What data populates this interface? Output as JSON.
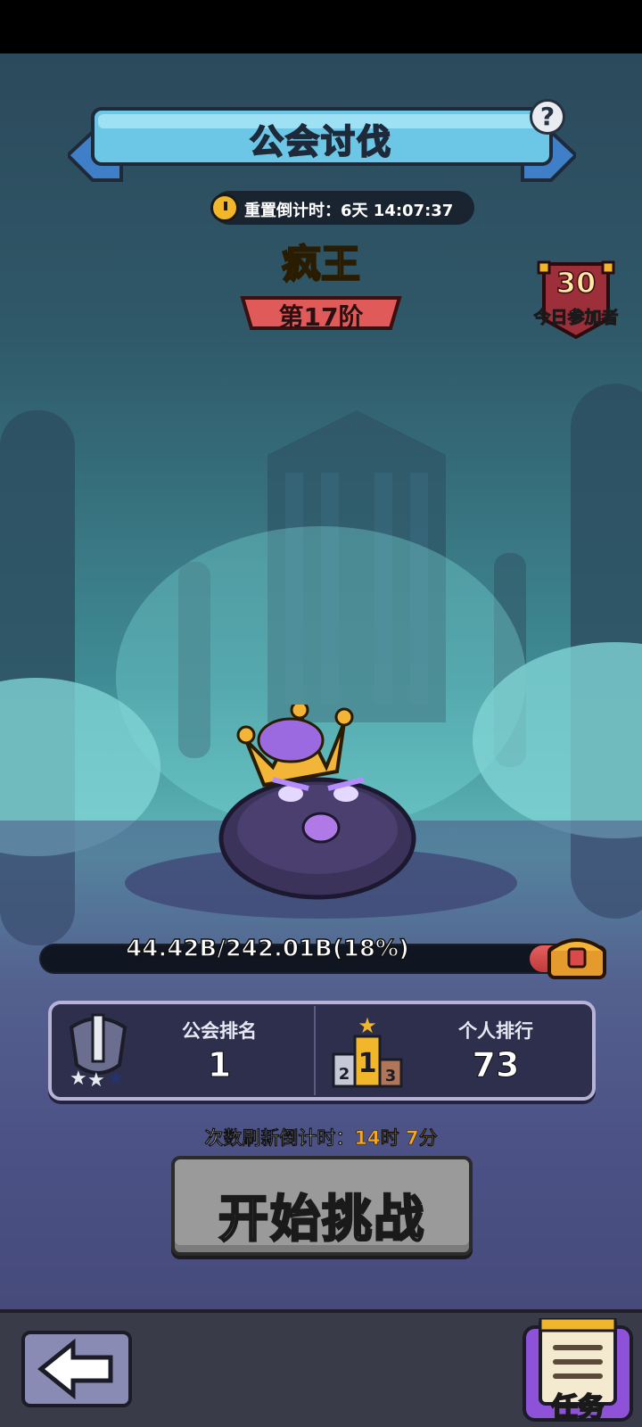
{
  "header": {
    "title": "公会讨伐",
    "help_icon": "question-icon",
    "reset_timer": "重置倒计时：6天 14:07:37"
  },
  "boss": {
    "name": "疯王",
    "tier": "第17阶"
  },
  "participants": {
    "count": "30",
    "label": "今日参加者"
  },
  "hp": {
    "text": "44.42B/242.01B(18%)",
    "fraction_remaining": 0.08
  },
  "ranking": {
    "guild_label": "公会排名",
    "guild_value": "1",
    "personal_label": "个人排行",
    "personal_value": "73",
    "podium_first": "1",
    "podium_second": "2",
    "podium_third": "3"
  },
  "refresh": {
    "label": "次数刷新倒计时：",
    "value": "14时 7分"
  },
  "actions": {
    "start_label": "开始挑战",
    "task_label": "任务"
  },
  "colors": {
    "title_banner": "#6cc6e6",
    "boss_name": "#f8d33a",
    "tier_badge": "#e05a5a",
    "hp_fill": "#d94a4b",
    "refresh_value": "#f5a623",
    "start_button": "#9a9a9a",
    "task_button": "#8e52d8"
  }
}
